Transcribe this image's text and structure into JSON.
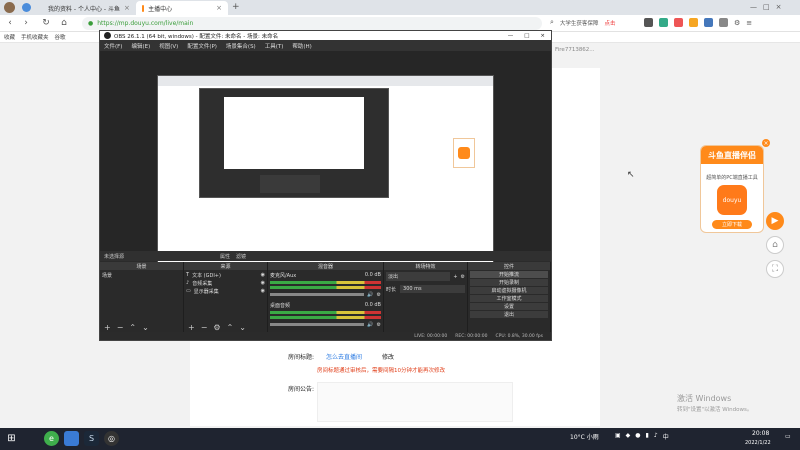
{
  "browser": {
    "tabs": [
      {
        "label": "我的资料 - 个人中心 - 斗鱼",
        "active": false
      },
      {
        "label": "主播中心",
        "active": true
      }
    ],
    "url": "https://mp.douyu.com/live/main",
    "search_text": "大学生获客保障",
    "search_btn": "点击",
    "bookmarks": [
      "收藏",
      "手机收藏夹",
      "谷歌"
    ]
  },
  "page": {
    "top_info": "Fire7713862...",
    "room_title_label": "房间标题:",
    "room_title_value": "怎么去直播间",
    "room_title_edit": "修改",
    "room_title_warn": "房间标题通过审核后，需要间隔10分钟才能再次修改",
    "announcement_label": "房间公告:"
  },
  "promo": {
    "title": "斗鱼直播伴侣",
    "subtitle": "超简单的PC端直播工具",
    "logo_text": "douyu",
    "button": "立即下载"
  },
  "obs": {
    "title": "OBS 26.1.1 (64 bit, windows) - 配置文件: 未命名 - 场景: 未命名",
    "menu": [
      "文件(F)",
      "编辑(E)",
      "视图(V)",
      "配置文件(P)",
      "场景集合(S)",
      "工具(T)",
      "帮助(H)"
    ],
    "toolbar": {
      "no_source": "未选择源",
      "properties": "属性",
      "filters": "滤镜"
    },
    "docks": {
      "scenes": {
        "header": "场景",
        "items": [
          "场景"
        ]
      },
      "sources": {
        "header": "来源",
        "items": [
          "文本 (GDI+)",
          "音频采集",
          "显示器采集"
        ]
      },
      "mixer": {
        "header": "混音器",
        "channels": [
          {
            "name": "麦克风/Aux",
            "db": "0.0 dB"
          },
          {
            "name": "桌面音频",
            "db": "0.0 dB"
          }
        ]
      },
      "transitions": {
        "header": "转场特效",
        "type": "淡出",
        "duration_label": "时长",
        "duration": "300 ms"
      },
      "controls": {
        "header": "控件",
        "buttons": [
          "开始推流",
          "开始录制",
          "启动虚拟摄像机",
          "工作室模式",
          "设置",
          "退出"
        ]
      }
    },
    "status": [
      "LIVE: 00:00:00",
      "REC: 00:00:00",
      "CPU: 0.8%, 30.00 fps"
    ]
  },
  "taskbar": {
    "weather": "10°C 小雨",
    "time": "20:08",
    "date": "2022/1/22"
  },
  "watermark": {
    "line1": "激活 Windows",
    "line2": "转到\"设置\"以激活 Windows。"
  }
}
